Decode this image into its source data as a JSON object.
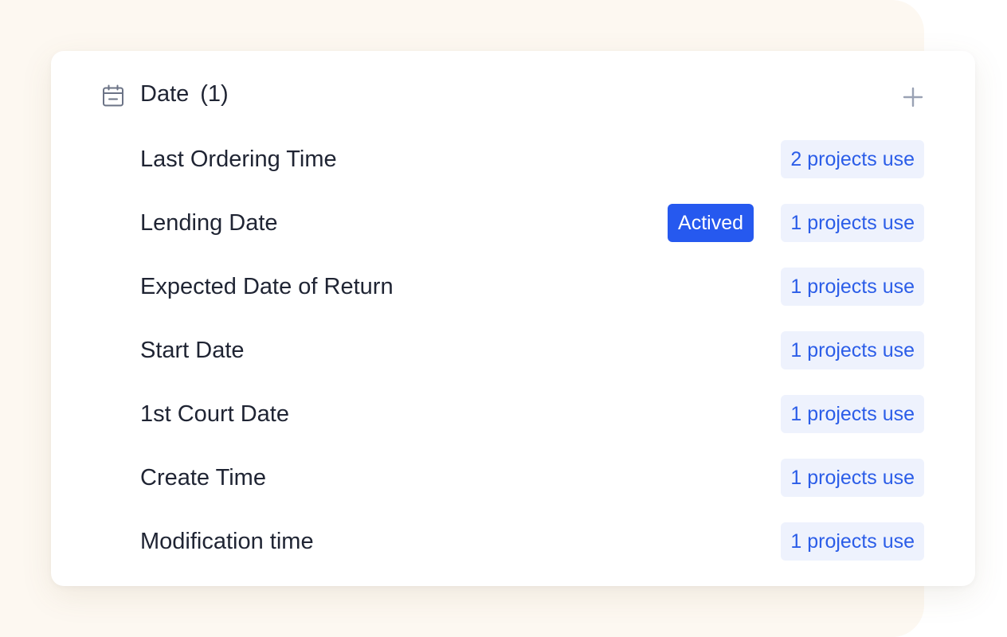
{
  "section": {
    "icon": "calendar-icon",
    "title": "Date",
    "count": "(1)",
    "add_icon": "plus-icon"
  },
  "fields": [
    {
      "label": "Last Ordering Time",
      "usage": "2 projects use",
      "badge": ""
    },
    {
      "label": "Lending Date",
      "usage": "1 projects use",
      "badge": "Actived"
    },
    {
      "label": "Expected Date of Return",
      "usage": "1 projects use",
      "badge": ""
    },
    {
      "label": "Start Date",
      "usage": "1 projects use",
      "badge": ""
    },
    {
      "label": "1st Court Date",
      "usage": "1 projects use",
      "badge": ""
    },
    {
      "label": "Create Time",
      "usage": "1 projects use",
      "badge": ""
    },
    {
      "label": "Modification time",
      "usage": "1 projects use",
      "badge": ""
    }
  ],
  "colors": {
    "text": "#1f2433",
    "accent": "#2659ef",
    "usage_bg": "#eef2fd",
    "usage_text": "#2b5de8",
    "backdrop": "#fdf8f1",
    "icon_gray": "#6b7386",
    "plus_gray": "#9aa2b4"
  }
}
